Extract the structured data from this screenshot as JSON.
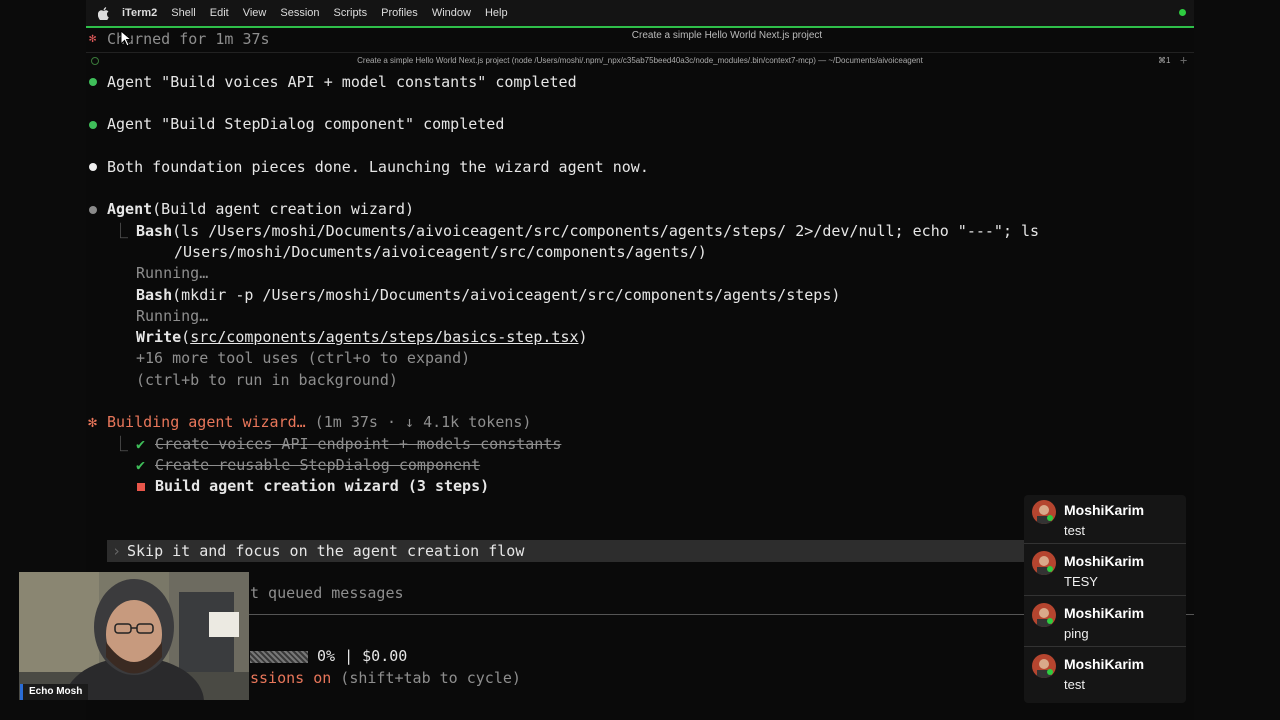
{
  "menubar": {
    "items": [
      "iTerm2",
      "Shell",
      "Edit",
      "View",
      "Session",
      "Scripts",
      "Profiles",
      "Window",
      "Help"
    ]
  },
  "window": {
    "title": "Create a simple Hello World Next.js project",
    "tab_title": "Create a simple Hello World Next.js project (node /Users/moshi/.npm/_npx/c35ab75beed40a3c/node_modules/.bin/context7-mcp) — ~/Documents/aivoiceagent",
    "tab_shortcut": "⌘1",
    "tab_add": "+"
  },
  "terminal": {
    "churned": "Churned for 1m 37s",
    "agent1": "Agent \"Build voices API + model constants\" completed",
    "agent2": "Agent \"Build StepDialog component\" completed",
    "foundation": "Both foundation pieces done. Launching the wizard agent now.",
    "agent_call_name": "Agent",
    "agent_call_args": "(Build agent creation wizard)",
    "bash1_name": "Bash",
    "bash1_args": "(ls /Users/moshi/Documents/aivoiceagent/src/components/agents/steps/ 2>/dev/null; echo \"---\"; ls",
    "bash1_cont": "/Users/moshi/Documents/aivoiceagent/src/components/agents/)",
    "running1": "Running…",
    "bash2_name": "Bash",
    "bash2_args": "(mkdir -p /Users/moshi/Documents/aivoiceagent/src/components/agents/steps)",
    "running2": "Running…",
    "write_name": "Write",
    "write_path": "src/components/agents/steps/basics-step.tsx",
    "more_tools": "+16 more tool uses (ctrl+o to expand)",
    "background_hint": "(ctrl+b to run in background)",
    "building": "Building agent wizard…",
    "building_meta": " (1m 37s · ↓ 4.1k tokens)",
    "todos": [
      {
        "label": "Create voices API endpoint + models constants",
        "done": true
      },
      {
        "label": "Create reusable StepDialog component",
        "done": true
      },
      {
        "label": "Build agent creation wizard (3 steps)",
        "done": false
      }
    ],
    "input_text": "Skip it and focus on the agent creation flow",
    "queued_hint": "t queued messages",
    "progress_text": "0% | $0.00",
    "permissions_prefix": "ssions on",
    "permissions_hint": " (shift+tab to cycle)"
  },
  "webcam": {
    "name": "Echo Mosh"
  },
  "chat": {
    "messages": [
      {
        "name": "MoshiKarim",
        "text": "test"
      },
      {
        "name": "MoshiKarim",
        "text": "TESY"
      },
      {
        "name": "MoshiKarim",
        "text": "ping"
      },
      {
        "name": "MoshiKarim",
        "text": "test"
      }
    ]
  },
  "colors": {
    "accent_green": "#3fbf5a",
    "status_orange": "#e8765a",
    "todo_red": "#e8564a"
  }
}
